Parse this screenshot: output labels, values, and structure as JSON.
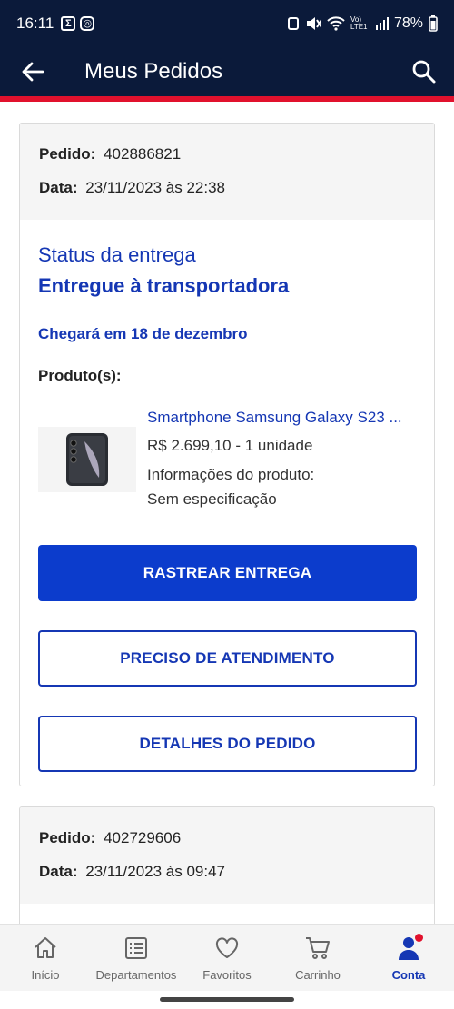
{
  "status_bar": {
    "time": "16:11",
    "battery": "78%",
    "network": "Vo) LTE1"
  },
  "app_bar": {
    "title": "Meus Pedidos",
    "icons": [
      "arrow-back-icon",
      "search-icon"
    ]
  },
  "colors": {
    "navy": "#0b1a3a",
    "accent_red": "#e1112d",
    "brand_blue": "#1537b4",
    "primary_button": "#0c3ccc"
  },
  "orders": [
    {
      "order_label": "Pedido:",
      "order_number": "402886821",
      "date_label": "Data:",
      "date_value": "23/11/2023 às 22:38",
      "status_title": "Status da entrega",
      "status_value": "Entregue à transportadora",
      "arrival": "Chegará em 18 de dezembro",
      "products_label": "Produto(s):",
      "product": {
        "name": "Smartphone Samsung Galaxy S23 ...",
        "price_qty": "R$ 2.699,10 - 1 unidade",
        "info_label": "Informações do produto:",
        "spec": "Sem especificação"
      },
      "buttons": {
        "track": "RASTREAR ENTREGA",
        "support": "PRECISO DE ATENDIMENTO",
        "details": "DETALHES DO PEDIDO"
      }
    },
    {
      "order_label": "Pedido:",
      "order_number": "402729606",
      "date_label": "Data:",
      "date_value": "23/11/2023 às 09:47"
    }
  ],
  "bottom_nav": [
    {
      "label": "Início",
      "icon": "home-icon",
      "active": false
    },
    {
      "label": "Departamentos",
      "icon": "list-icon",
      "active": false
    },
    {
      "label": "Favoritos",
      "icon": "heart-icon",
      "active": false
    },
    {
      "label": "Carrinho",
      "icon": "cart-icon",
      "active": false
    },
    {
      "label": "Conta",
      "icon": "user-icon",
      "active": true
    }
  ]
}
